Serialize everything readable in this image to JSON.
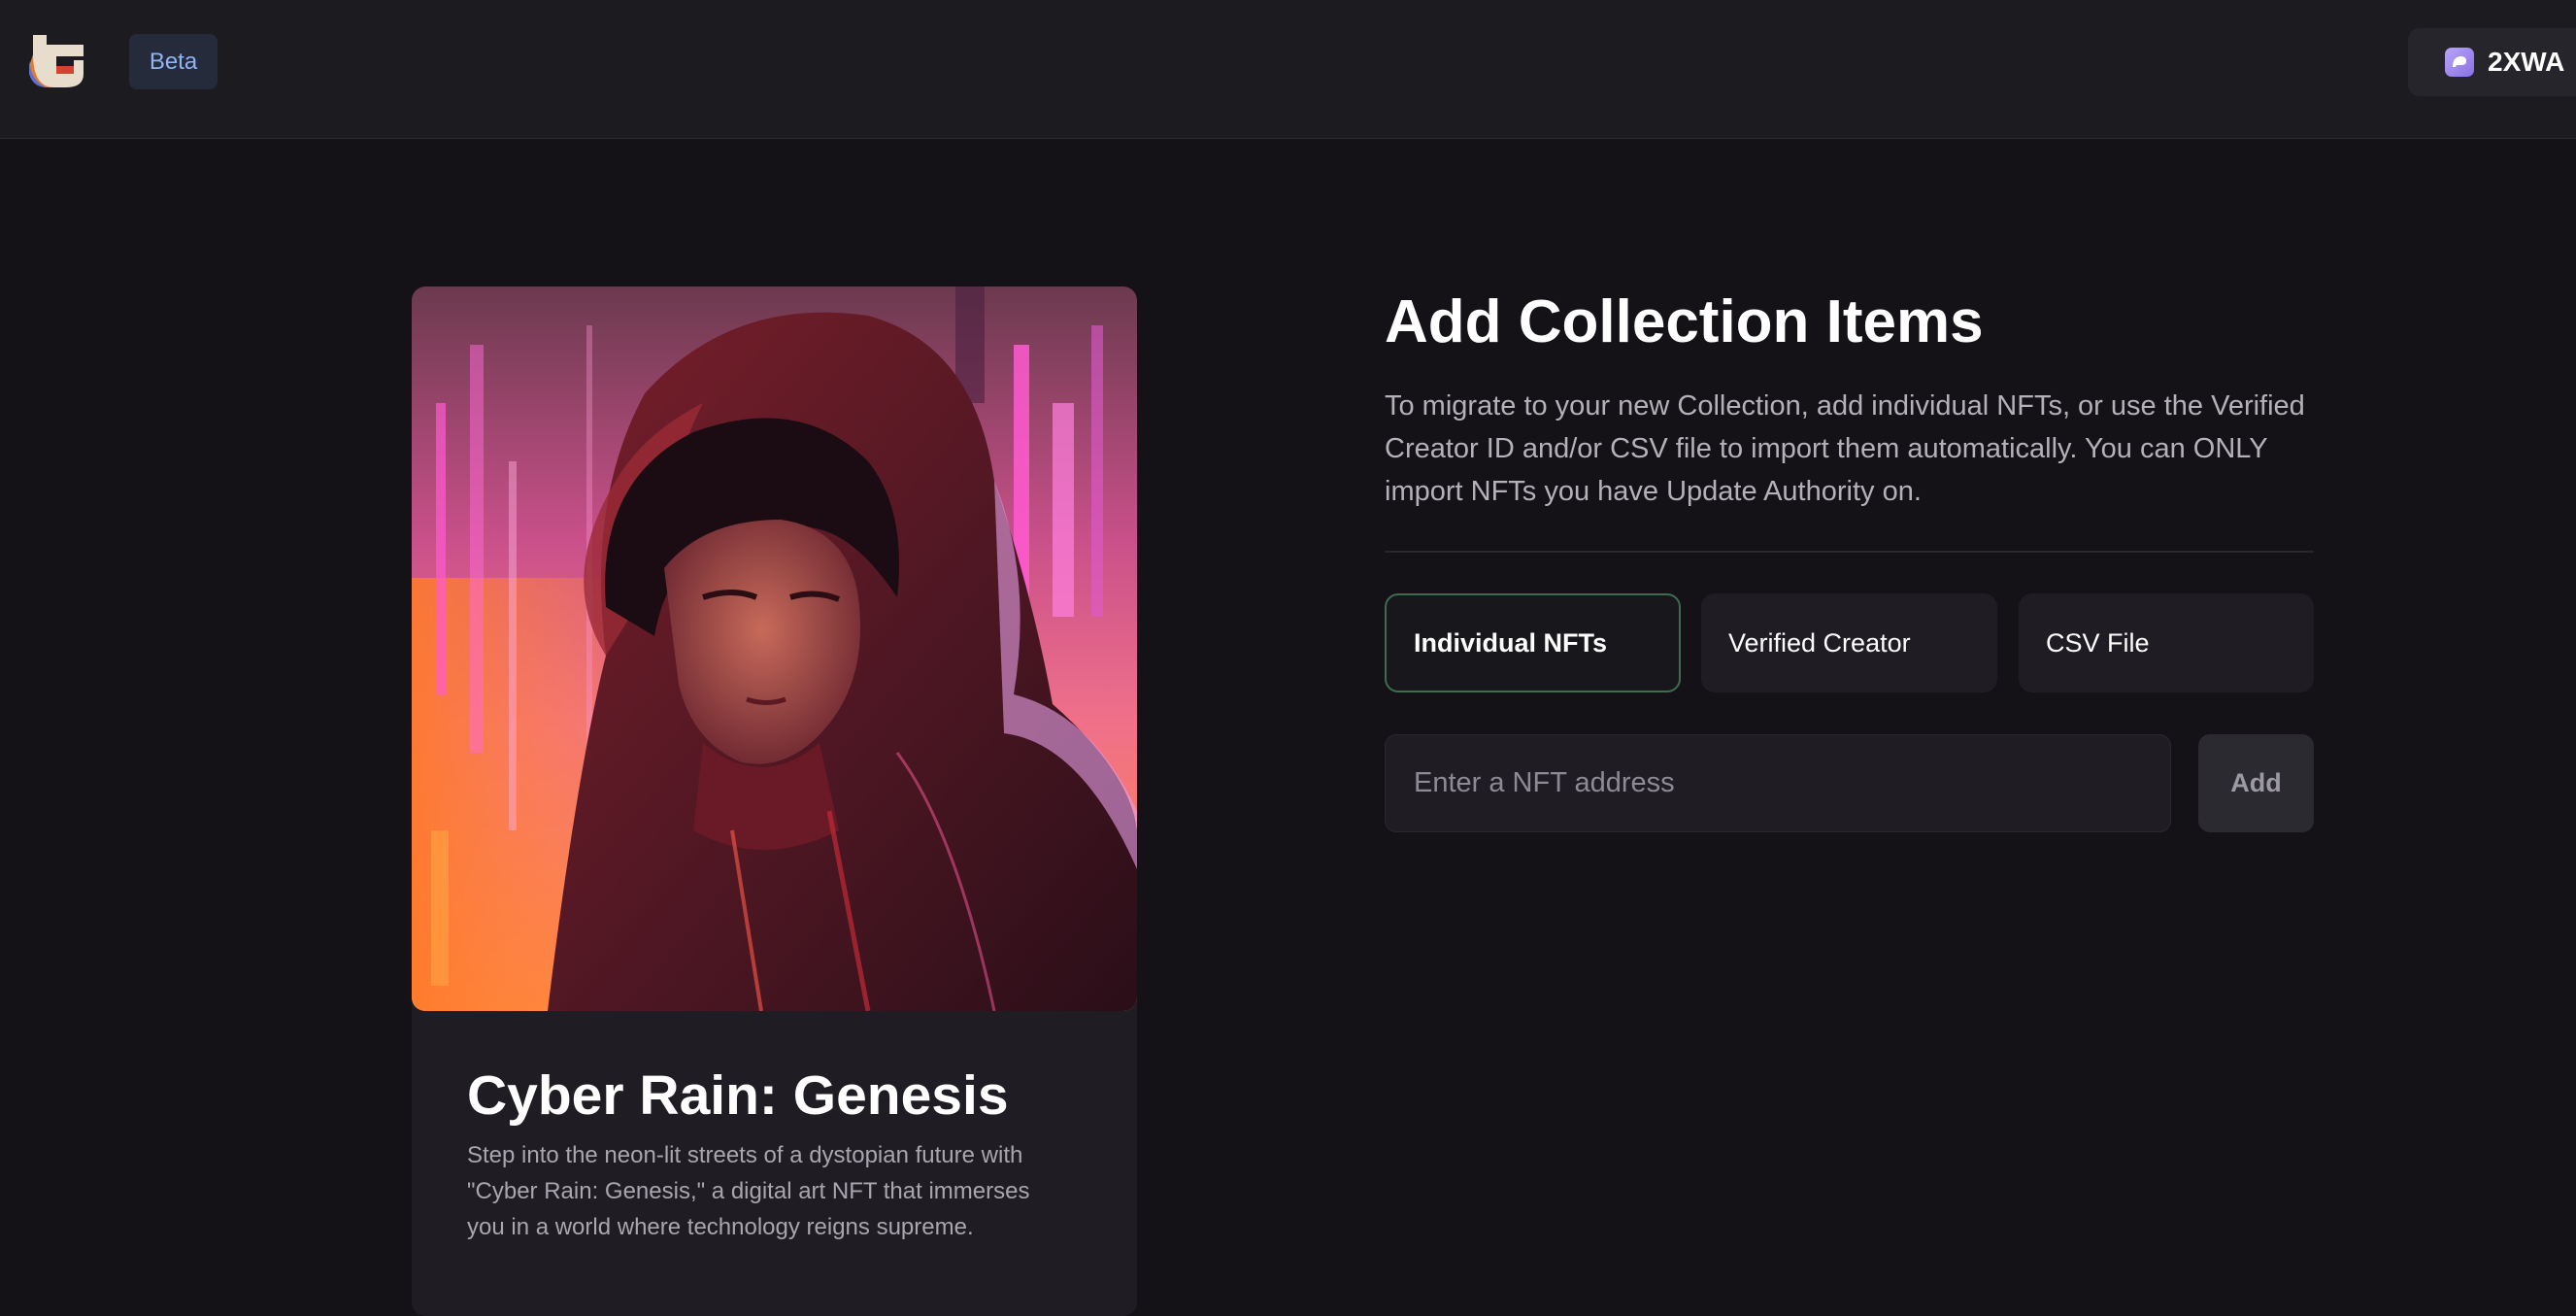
{
  "header": {
    "logo_icon": "app-logo-icon",
    "beta_label": "Beta",
    "wallet": {
      "icon": "wallet-icon",
      "label": "2XWA"
    }
  },
  "nft_card": {
    "image_icon": "nft-artwork",
    "title": "Cyber Rain: Genesis",
    "description": "Step into the neon-lit streets of a dystopian future with \"Cyber Rain: Genesis,\" a digital art NFT that immerses you in a world where technology reigns supreme."
  },
  "main": {
    "title": "Add Collection Items",
    "description": "To migrate to your new Collection, add individual NFTs, or use the Verified Creator ID and/or CSV file to import them automatically. You can ONLY import NFTs you have Update Authority on.",
    "tabs": [
      {
        "label": "Individual NFTs",
        "active": true
      },
      {
        "label": "Verified Creator",
        "active": false
      },
      {
        "label": "CSV File",
        "active": false
      }
    ],
    "address_input": {
      "placeholder": "Enter a NFT address",
      "value": ""
    },
    "add_button_label": "Add"
  },
  "colors": {
    "background": "#141217",
    "header": "#1c1b20",
    "card": "#1f1d23",
    "active_tab_border": "#3f6b4e",
    "beta_text": "#8fb3f5"
  }
}
